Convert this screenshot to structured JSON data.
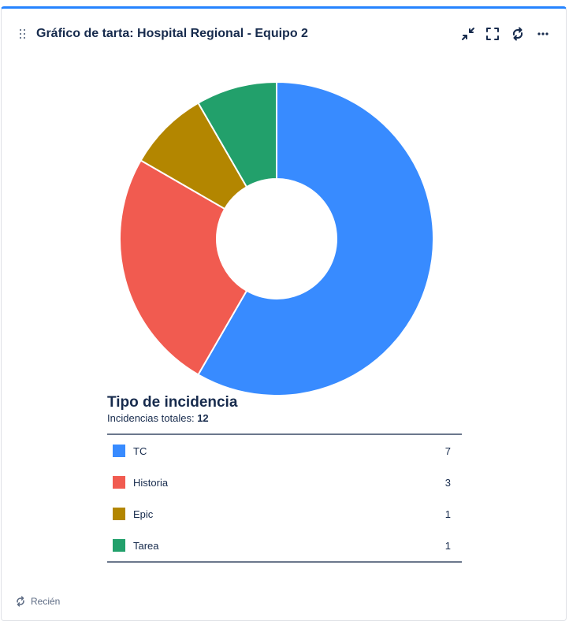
{
  "header": {
    "title": "Gráfico de tarta: Hospital Regional - Equipo 2",
    "icons": [
      "drag-handle-icon",
      "minimize-icon",
      "fullscreen-icon",
      "refresh-icon",
      "more-icon"
    ]
  },
  "chart_data": {
    "type": "pie",
    "title": "",
    "categories": [
      "TC",
      "Historia",
      "Epic",
      "Tarea"
    ],
    "values": [
      7,
      3,
      1,
      1
    ],
    "colors": [
      "#388bff",
      "#f15b50",
      "#b38600",
      "#22a06b"
    ],
    "donut": true
  },
  "legend": {
    "title": "Tipo de incidencia",
    "total_label": "Incidencias totales:",
    "total_value": "12",
    "rows": [
      {
        "label": "TC",
        "count": "7",
        "color": "#388bff"
      },
      {
        "label": "Historia",
        "count": "3",
        "color": "#f15b50"
      },
      {
        "label": "Epic",
        "count": "1",
        "color": "#b38600"
      },
      {
        "label": "Tarea",
        "count": "1",
        "color": "#22a06b"
      }
    ]
  },
  "footer": {
    "status": "Recién",
    "icon": "refresh-icon"
  }
}
